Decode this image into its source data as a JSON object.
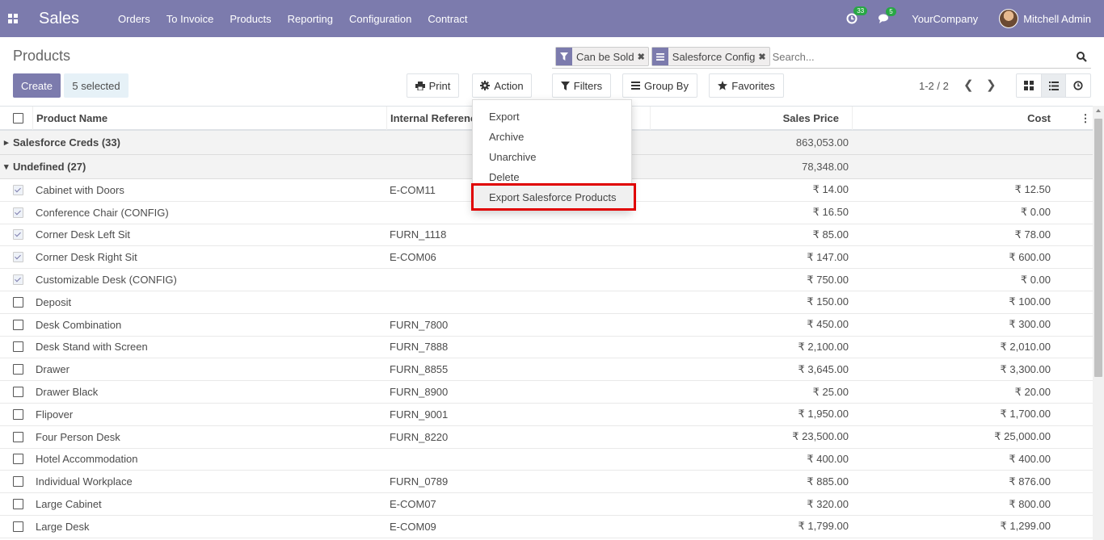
{
  "navbar": {
    "app_name": "Sales",
    "menu": [
      "Orders",
      "To Invoice",
      "Products",
      "Reporting",
      "Configuration",
      "Contract"
    ],
    "activity_count": "33",
    "messages_count": "5",
    "company": "YourCompany",
    "user": "Mitchell Admin"
  },
  "control_panel": {
    "title": "Products",
    "create_label": "Create",
    "selected_label": "5 selected",
    "print_label": "Print",
    "action_label": "Action",
    "filters_label": "Filters",
    "groupby_label": "Group By",
    "favorites_label": "Favorites",
    "pager": "1-2 / 2",
    "facets": [
      "Can be Sold",
      "Salesforce Config"
    ],
    "search_placeholder": "Search..."
  },
  "action_menu": {
    "items": [
      "Export",
      "Archive",
      "Unarchive",
      "Delete",
      "Export Salesforce Products"
    ]
  },
  "table": {
    "headers": {
      "name": "Product Name",
      "ref": "Internal Reference",
      "price": "Sales Price",
      "cost": "Cost"
    },
    "groups": [
      {
        "label": "Salesforce Creds (33)",
        "price": "863,053.00",
        "expanded": false
      },
      {
        "label": "Undefined (27)",
        "price": "78,348.00",
        "expanded": true
      }
    ],
    "rows": [
      {
        "name": "Cabinet with Doors",
        "ref": "E-COM11",
        "price": "₹ 14.00",
        "cost": "₹ 12.50",
        "checked": true
      },
      {
        "name": "Conference Chair (CONFIG)",
        "ref": "",
        "price": "₹ 16.50",
        "cost": "₹ 0.00",
        "checked": true
      },
      {
        "name": "Corner Desk Left Sit",
        "ref": "FURN_1118",
        "price": "₹ 85.00",
        "cost": "₹ 78.00",
        "checked": true
      },
      {
        "name": "Corner Desk Right Sit",
        "ref": "E-COM06",
        "price": "₹ 147.00",
        "cost": "₹ 600.00",
        "checked": true
      },
      {
        "name": "Customizable Desk (CONFIG)",
        "ref": "",
        "price": "₹ 750.00",
        "cost": "₹ 0.00",
        "checked": true
      },
      {
        "name": "Deposit",
        "ref": "",
        "price": "₹ 150.00",
        "cost": "₹ 100.00",
        "checked": false
      },
      {
        "name": "Desk Combination",
        "ref": "FURN_7800",
        "price": "₹ 450.00",
        "cost": "₹ 300.00",
        "checked": false
      },
      {
        "name": "Desk Stand with Screen",
        "ref": "FURN_7888",
        "price": "₹ 2,100.00",
        "cost": "₹ 2,010.00",
        "checked": false
      },
      {
        "name": "Drawer",
        "ref": "FURN_8855",
        "price": "₹ 3,645.00",
        "cost": "₹ 3,300.00",
        "checked": false
      },
      {
        "name": "Drawer Black",
        "ref": "FURN_8900",
        "price": "₹ 25.00",
        "cost": "₹ 20.00",
        "checked": false
      },
      {
        "name": "Flipover",
        "ref": "FURN_9001",
        "price": "₹ 1,950.00",
        "cost": "₹ 1,700.00",
        "checked": false
      },
      {
        "name": "Four Person Desk",
        "ref": "FURN_8220",
        "price": "₹ 23,500.00",
        "cost": "₹ 25,000.00",
        "checked": false
      },
      {
        "name": "Hotel Accommodation",
        "ref": "",
        "price": "₹ 400.00",
        "cost": "₹ 400.00",
        "checked": false
      },
      {
        "name": "Individual Workplace",
        "ref": "FURN_0789",
        "price": "₹ 885.00",
        "cost": "₹ 876.00",
        "checked": false
      },
      {
        "name": "Large Cabinet",
        "ref": "E-COM07",
        "price": "₹ 320.00",
        "cost": "₹ 800.00",
        "checked": false
      },
      {
        "name": "Large Desk",
        "ref": "E-COM09",
        "price": "₹ 1,799.00",
        "cost": "₹ 1,299.00",
        "checked": false
      }
    ]
  },
  "colors": {
    "brand": "#7c7bad",
    "highlight_border": "#e00000",
    "badge": "#28a745"
  }
}
